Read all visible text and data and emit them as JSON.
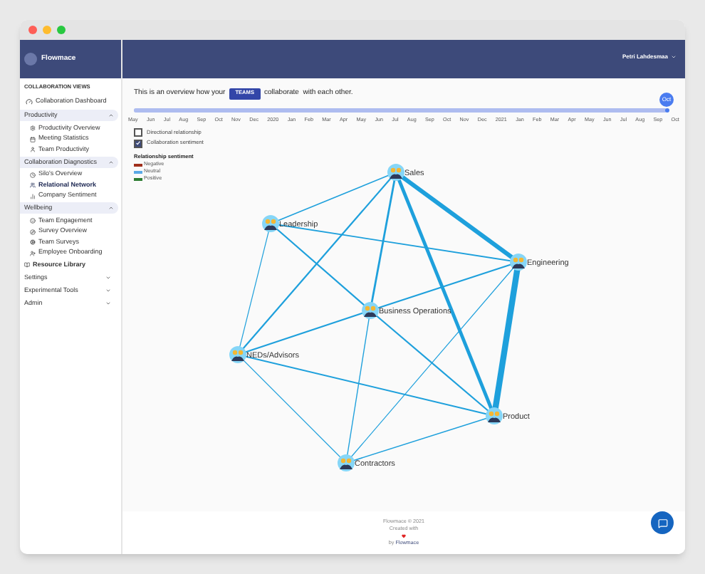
{
  "sidebar": {
    "brand": "Flowmace",
    "section_title": "COLLABORATION VIEWS",
    "dashboard": "Collaboration Dashboard",
    "groups": [
      {
        "label": "Productivity",
        "expanded": true,
        "items": [
          {
            "label": "Productivity Overview",
            "selected": false
          },
          {
            "label": "Meeting Statistics",
            "selected": false
          },
          {
            "label": "Team Productivity",
            "selected": false
          }
        ]
      },
      {
        "label": "Collaboration Diagnostics",
        "expanded": true,
        "items": [
          {
            "label": "Silo's Overview",
            "selected": false
          },
          {
            "label": "Relational Network",
            "selected": true
          },
          {
            "label": "Company Sentiment",
            "selected": false
          }
        ]
      },
      {
        "label": "Wellbeing",
        "expanded": true,
        "items": [
          {
            "label": "Team Engagement",
            "selected": false
          },
          {
            "label": "Survey Overview",
            "selected": false
          },
          {
            "label": "Team Surveys",
            "selected": false
          },
          {
            "label": "Employee Onboarding",
            "selected": false
          }
        ]
      }
    ],
    "resource_library": "Resource Library",
    "collapsed": [
      {
        "label": "Settings",
        "expanded": false
      },
      {
        "label": "Experimental Tools",
        "expanded": false
      },
      {
        "label": "Admin",
        "expanded": false
      }
    ]
  },
  "header": {
    "user": "Petri Lahdesmaa"
  },
  "intro": {
    "before": "This is an overview how your",
    "button": "TEAMS",
    "after": "collaborate  with each other."
  },
  "timeline": {
    "months": [
      "May",
      "Jun",
      "Jul",
      "Aug",
      "Sep",
      "Oct",
      "Nov",
      "Dec",
      "2020",
      "Jan",
      "Feb",
      "Mar",
      "Apr",
      "May",
      "Jun",
      "Jul",
      "Aug",
      "Sep",
      "Oct",
      "Nov",
      "Dec",
      "2021",
      "Jan",
      "Feb",
      "Mar",
      "Apr",
      "May",
      "Jun",
      "Jul",
      "Aug",
      "Sep",
      "Oct"
    ],
    "thumb_label": "Oct",
    "level": 1
  },
  "options": [
    {
      "label": "Directional relationship",
      "checked": false
    },
    {
      "label": "Collaboration sentiment",
      "checked": true
    }
  ],
  "legend": {
    "title": "Relationship sentiment",
    "items": [
      {
        "label": "Negative",
        "color": "#a0301c"
      },
      {
        "label": "Neutral",
        "color": "#5aa9e6"
      },
      {
        "label": "Positive",
        "color": "#2e7d32"
      }
    ]
  },
  "nodes": [
    "Sales",
    "Leadership",
    "Engineering",
    "Business Operations",
    "NEDs/Advisors",
    "Product",
    "Contractors"
  ],
  "footer": {
    "copyright": "Flowmace © 2021",
    "created": "Created with",
    "by": "by",
    "brand": "Flowmace"
  }
}
